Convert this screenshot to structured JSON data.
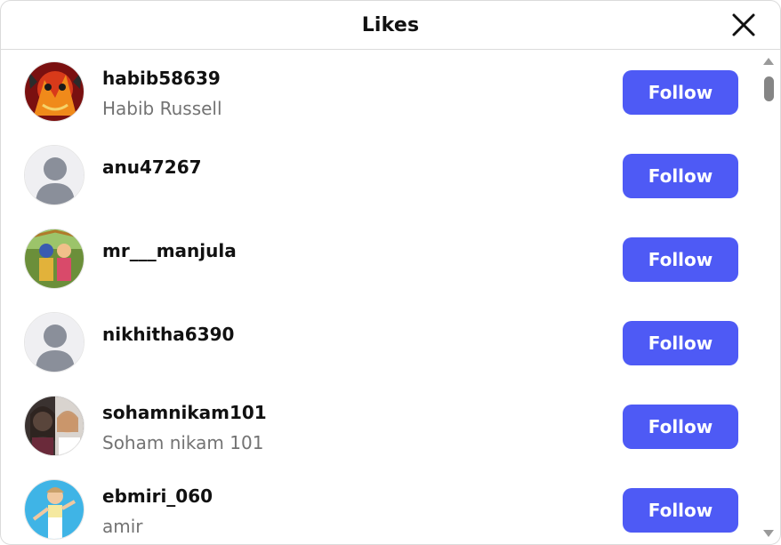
{
  "dialog": {
    "title": "Likes",
    "close_icon": "close-icon"
  },
  "colors": {
    "follow_button": "#4e5af5",
    "secondary_text": "#737373"
  },
  "users": [
    {
      "username": "habib58639",
      "full_name": "Habib Russell",
      "avatar": "photo-red-illustration",
      "follow_label": "Follow"
    },
    {
      "username": "anu47267",
      "full_name": "",
      "avatar": "default-avatar",
      "follow_label": "Follow"
    },
    {
      "username": "mr___manjula",
      "full_name": "",
      "avatar": "photo-deities",
      "follow_label": "Follow"
    },
    {
      "username": "nikhitha6390",
      "full_name": "",
      "avatar": "default-avatar",
      "follow_label": "Follow"
    },
    {
      "username": "sohamnikam101",
      "full_name": "Soham nikam 101",
      "avatar": "photo-two-girls",
      "follow_label": "Follow"
    },
    {
      "username": "ebmiri_060",
      "full_name": "amir",
      "avatar": "photo-cartoon-figure",
      "follow_label": "Follow"
    }
  ]
}
